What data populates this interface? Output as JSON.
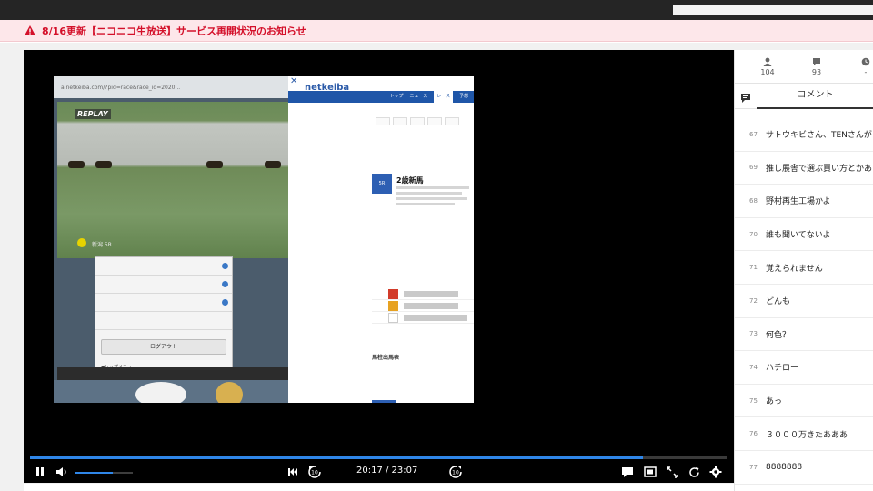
{
  "notice": {
    "text": "8/16更新【ニコニコ生放送】サービス再開状況のお知らせ",
    "icon": "warning-icon",
    "color": "#d4102a"
  },
  "video": {
    "stream": {
      "url_text": "a.netkeiba.com/?pid=race&race_id=2020...",
      "replay_label": "REPLAY",
      "track_label": "新潟 5R",
      "logout_label": "ログアウト",
      "back_link": "◀トップメニュー",
      "page_logo": "netkeiba",
      "page_nav": [
        "トップ",
        "ニュース",
        "レース",
        "予想"
      ],
      "race_name": "2歳新馬",
      "race_badge": "5R",
      "section_label": "馬柱出馬表"
    }
  },
  "player": {
    "progress": 0.88,
    "volume": 0.65,
    "time": "20:17 / 23:07",
    "accent": "#2f86e8"
  },
  "side": {
    "stats": [
      {
        "icon": "user-icon",
        "value": "104"
      },
      {
        "icon": "comment-icon",
        "value": "93"
      },
      {
        "icon": "clock-icon",
        "value": "-"
      }
    ],
    "tab_label": "コメント",
    "comments": [
      {
        "num": "67",
        "text": "サトウキビさん、TENさんが"
      },
      {
        "num": "69",
        "text": "推し展舎で選ぶ買い方とかあ"
      },
      {
        "num": "68",
        "text": "野村再生工場かよ"
      },
      {
        "num": "70",
        "text": "誰も聞いてないよ"
      },
      {
        "num": "71",
        "text": "覚えられません"
      },
      {
        "num": "72",
        "text": "どんも"
      },
      {
        "num": "73",
        "text": "何色？"
      },
      {
        "num": "74",
        "text": "ハチロー"
      },
      {
        "num": "75",
        "text": "あっ"
      },
      {
        "num": "76",
        "text": "３０００万きたあああ"
      },
      {
        "num": "77",
        "text": "8888888"
      }
    ]
  }
}
